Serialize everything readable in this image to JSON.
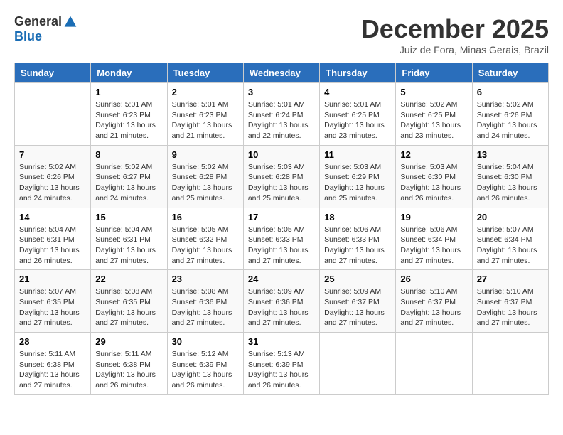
{
  "header": {
    "logo_general": "General",
    "logo_blue": "Blue",
    "month_title": "December 2025",
    "subtitle": "Juiz de Fora, Minas Gerais, Brazil"
  },
  "weekdays": [
    "Sunday",
    "Monday",
    "Tuesday",
    "Wednesday",
    "Thursday",
    "Friday",
    "Saturday"
  ],
  "weeks": [
    [
      {
        "day": "",
        "info": ""
      },
      {
        "day": "1",
        "info": "Sunrise: 5:01 AM\nSunset: 6:23 PM\nDaylight: 13 hours\nand 21 minutes."
      },
      {
        "day": "2",
        "info": "Sunrise: 5:01 AM\nSunset: 6:23 PM\nDaylight: 13 hours\nand 21 minutes."
      },
      {
        "day": "3",
        "info": "Sunrise: 5:01 AM\nSunset: 6:24 PM\nDaylight: 13 hours\nand 22 minutes."
      },
      {
        "day": "4",
        "info": "Sunrise: 5:01 AM\nSunset: 6:25 PM\nDaylight: 13 hours\nand 23 minutes."
      },
      {
        "day": "5",
        "info": "Sunrise: 5:02 AM\nSunset: 6:25 PM\nDaylight: 13 hours\nand 23 minutes."
      },
      {
        "day": "6",
        "info": "Sunrise: 5:02 AM\nSunset: 6:26 PM\nDaylight: 13 hours\nand 24 minutes."
      }
    ],
    [
      {
        "day": "7",
        "info": "Sunrise: 5:02 AM\nSunset: 6:26 PM\nDaylight: 13 hours\nand 24 minutes."
      },
      {
        "day": "8",
        "info": "Sunrise: 5:02 AM\nSunset: 6:27 PM\nDaylight: 13 hours\nand 24 minutes."
      },
      {
        "day": "9",
        "info": "Sunrise: 5:02 AM\nSunset: 6:28 PM\nDaylight: 13 hours\nand 25 minutes."
      },
      {
        "day": "10",
        "info": "Sunrise: 5:03 AM\nSunset: 6:28 PM\nDaylight: 13 hours\nand 25 minutes."
      },
      {
        "day": "11",
        "info": "Sunrise: 5:03 AM\nSunset: 6:29 PM\nDaylight: 13 hours\nand 25 minutes."
      },
      {
        "day": "12",
        "info": "Sunrise: 5:03 AM\nSunset: 6:30 PM\nDaylight: 13 hours\nand 26 minutes."
      },
      {
        "day": "13",
        "info": "Sunrise: 5:04 AM\nSunset: 6:30 PM\nDaylight: 13 hours\nand 26 minutes."
      }
    ],
    [
      {
        "day": "14",
        "info": "Sunrise: 5:04 AM\nSunset: 6:31 PM\nDaylight: 13 hours\nand 26 minutes."
      },
      {
        "day": "15",
        "info": "Sunrise: 5:04 AM\nSunset: 6:31 PM\nDaylight: 13 hours\nand 27 minutes."
      },
      {
        "day": "16",
        "info": "Sunrise: 5:05 AM\nSunset: 6:32 PM\nDaylight: 13 hours\nand 27 minutes."
      },
      {
        "day": "17",
        "info": "Sunrise: 5:05 AM\nSunset: 6:33 PM\nDaylight: 13 hours\nand 27 minutes."
      },
      {
        "day": "18",
        "info": "Sunrise: 5:06 AM\nSunset: 6:33 PM\nDaylight: 13 hours\nand 27 minutes."
      },
      {
        "day": "19",
        "info": "Sunrise: 5:06 AM\nSunset: 6:34 PM\nDaylight: 13 hours\nand 27 minutes."
      },
      {
        "day": "20",
        "info": "Sunrise: 5:07 AM\nSunset: 6:34 PM\nDaylight: 13 hours\nand 27 minutes."
      }
    ],
    [
      {
        "day": "21",
        "info": "Sunrise: 5:07 AM\nSunset: 6:35 PM\nDaylight: 13 hours\nand 27 minutes."
      },
      {
        "day": "22",
        "info": "Sunrise: 5:08 AM\nSunset: 6:35 PM\nDaylight: 13 hours\nand 27 minutes."
      },
      {
        "day": "23",
        "info": "Sunrise: 5:08 AM\nSunset: 6:36 PM\nDaylight: 13 hours\nand 27 minutes."
      },
      {
        "day": "24",
        "info": "Sunrise: 5:09 AM\nSunset: 6:36 PM\nDaylight: 13 hours\nand 27 minutes."
      },
      {
        "day": "25",
        "info": "Sunrise: 5:09 AM\nSunset: 6:37 PM\nDaylight: 13 hours\nand 27 minutes."
      },
      {
        "day": "26",
        "info": "Sunrise: 5:10 AM\nSunset: 6:37 PM\nDaylight: 13 hours\nand 27 minutes."
      },
      {
        "day": "27",
        "info": "Sunrise: 5:10 AM\nSunset: 6:37 PM\nDaylight: 13 hours\nand 27 minutes."
      }
    ],
    [
      {
        "day": "28",
        "info": "Sunrise: 5:11 AM\nSunset: 6:38 PM\nDaylight: 13 hours\nand 27 minutes."
      },
      {
        "day": "29",
        "info": "Sunrise: 5:11 AM\nSunset: 6:38 PM\nDaylight: 13 hours\nand 26 minutes."
      },
      {
        "day": "30",
        "info": "Sunrise: 5:12 AM\nSunset: 6:39 PM\nDaylight: 13 hours\nand 26 minutes."
      },
      {
        "day": "31",
        "info": "Sunrise: 5:13 AM\nSunset: 6:39 PM\nDaylight: 13 hours\nand 26 minutes."
      },
      {
        "day": "",
        "info": ""
      },
      {
        "day": "",
        "info": ""
      },
      {
        "day": "",
        "info": ""
      }
    ]
  ]
}
